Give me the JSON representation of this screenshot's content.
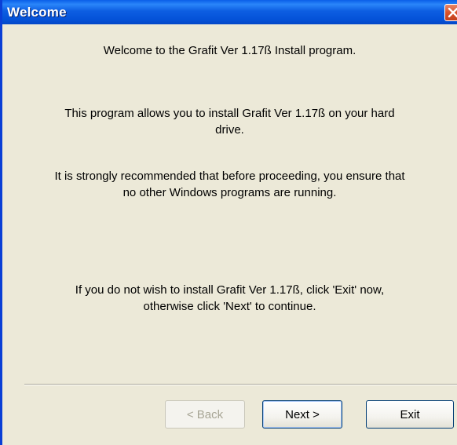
{
  "window": {
    "title": "Welcome"
  },
  "content": {
    "p1": "Welcome to the Grafit Ver 1.17ß Install program.",
    "p2": "This program allows you to install Grafit Ver 1.17ß on your hard\ndrive.",
    "p3": "It is strongly recommended that before proceeding, you ensure that\nno other Windows programs are running.",
    "p4": "If you do not wish to install Grafit Ver 1.17ß, click 'Exit' now,\notherwise click 'Next' to continue."
  },
  "buttons": {
    "back": {
      "label": "< Back",
      "enabled": false
    },
    "next": {
      "label": "Next >",
      "enabled": true,
      "default": true
    },
    "exit": {
      "label": "Exit",
      "enabled": true
    }
  },
  "colors": {
    "titlebar": "#0452d8",
    "dialog_bg": "#ece9d8",
    "close_button": "#d9532a"
  },
  "icons": {
    "close": "close-icon"
  }
}
